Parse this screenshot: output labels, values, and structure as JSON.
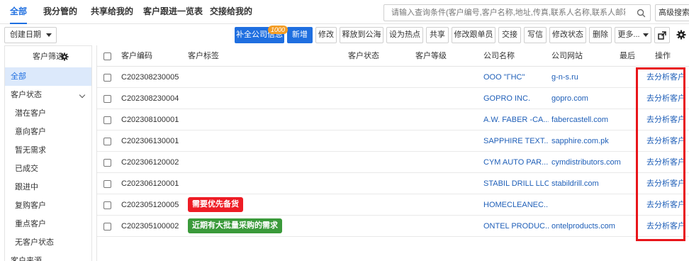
{
  "tabs": [
    {
      "label": "全部",
      "active": true
    },
    {
      "label": "我分管的"
    },
    {
      "label": "共享给我的"
    },
    {
      "label": "客户跟进一览表"
    },
    {
      "label": "交接给我的"
    }
  ],
  "search": {
    "placeholder": "请输入查询条件(客户编号,客户名称,地址,传真,联系人名称,联系人邮箱,电话,手机)...",
    "icon": "search-icon"
  },
  "advanced_search_label": "高级搜索",
  "toolbar": {
    "sort_value": "创建日期",
    "buttons": [
      "补全公司信息",
      "新增",
      "修改",
      "释放到公海",
      "设为热点",
      "共享",
      "修改跟单员",
      "交接",
      "写信",
      "修改状态",
      "删除",
      "更多..."
    ],
    "badge": "1000",
    "icons": [
      "export-icon",
      "settings-icon"
    ]
  },
  "sidebar": {
    "title": "客户筛选",
    "title_icon": "gear-icon",
    "items": [
      {
        "label": "全部",
        "active": true
      },
      {
        "label": "客户状态",
        "expandable": true
      },
      {
        "label": "潜在客户"
      },
      {
        "label": "意向客户"
      },
      {
        "label": "暂无需求"
      },
      {
        "label": "已成交"
      },
      {
        "label": "跟进中"
      },
      {
        "label": "复购客户"
      },
      {
        "label": "重点客户"
      },
      {
        "label": "无客户状态"
      },
      {
        "label": "客户来源"
      }
    ]
  },
  "table": {
    "headers": [
      "客户编码",
      "客户标签",
      "客户状态",
      "客户等级",
      "公司名称",
      "公司网站",
      "最后",
      "操作"
    ],
    "action_label": "去分析客户",
    "rows": [
      {
        "code": "C202308230005",
        "tag": "",
        "company": "OOO \"ГНС\"",
        "website": "g-n-s.ru"
      },
      {
        "code": "C202308230004",
        "tag": "",
        "company": "GOPRO INC.",
        "website": "gopro.com"
      },
      {
        "code": "C202308100001",
        "tag": "",
        "company": "A.W. FABER -CA...",
        "website": "fabercastell.com"
      },
      {
        "code": "C202306130001",
        "tag": "",
        "company": "SAPPHIRE TEXT...",
        "website": "sapphire.com.pk"
      },
      {
        "code": "C202306120002",
        "tag": "",
        "company": "CYM AUTO PAR...",
        "website": "cymdistributors.com"
      },
      {
        "code": "C202306120001",
        "tag": "",
        "company": "STABIL DRILL LLC",
        "website": "stabildrill.com"
      },
      {
        "code": "C202305120005",
        "tag": "需要优先备货",
        "tag_color": "#ee1c25",
        "company": "HOMECLEANEC...",
        "website": ""
      },
      {
        "code": "C202305100002",
        "tag": "近期有大批量采购的需求",
        "tag_color": "#3a9a3a",
        "company": "ONTEL PRODUC...",
        "website": "ontelproducts.com"
      }
    ]
  },
  "colors": {
    "accent": "#1f6fe0",
    "highlight": "#e8151a",
    "link": "#1f5fb8",
    "badge": "#f39c24"
  }
}
